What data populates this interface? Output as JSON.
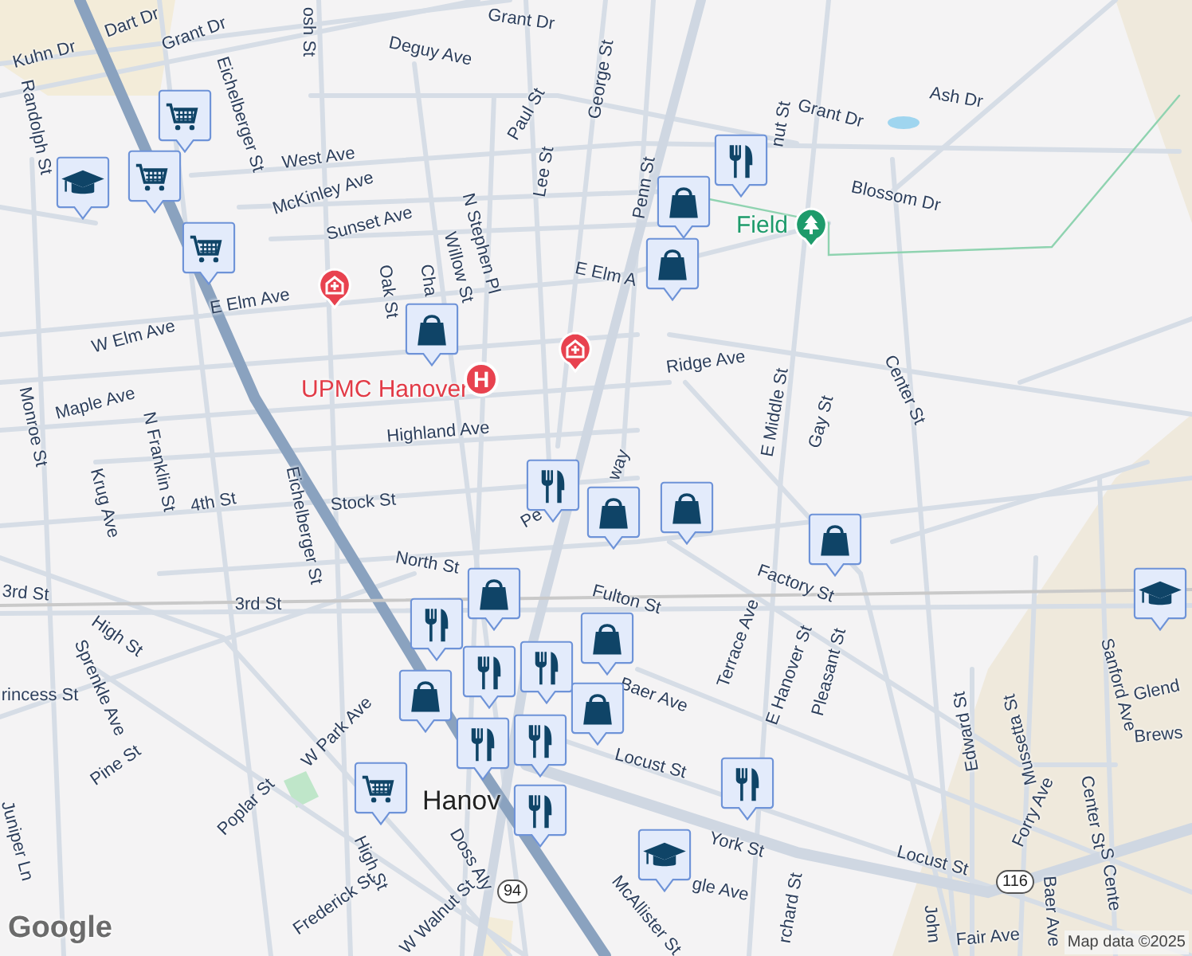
{
  "streets": [
    "Dart Dr",
    "Kuhn Dr",
    "Grant Dr",
    "Grant Dr",
    "Deguy Ave",
    "osh St",
    "Randolph St",
    "Eichelberger St",
    "Paul St",
    "West Ave",
    "McKinley Ave",
    "Sunset Ave",
    "Lee St",
    "N Stephen Pl",
    "Willow St",
    "E Elm Ave",
    "W Elm Ave",
    "Cha",
    "Oak St",
    "Maple Ave",
    "N Franklin St",
    "Monroe St",
    "Krug Ave",
    "Highland Ave",
    "Eichelberger St",
    "Stock St",
    "4th St",
    "George St",
    "Penn St",
    "Grant Dr",
    "Ash Dr",
    "Blossom Dr",
    "nut St",
    "E Elm A",
    "Ridge Ave",
    "E Middle St",
    "Gay St",
    "Center St",
    "way",
    "Pe",
    "North St",
    "3rd St",
    "3rd St",
    "High St",
    "Fulton St",
    "Factory St",
    "Terrace Ave",
    "E Hanover St",
    "Pleasant St",
    "Baer Ave",
    "rincess St",
    "Sprenkle Ave",
    "Pine St",
    "Juniper Ln",
    "W Park Ave",
    "Poplar St",
    "High St",
    "Locust St",
    "Locust St",
    "Doss Aly",
    "Frederick St",
    "W Walnut St",
    "York St",
    "McAllister St",
    "gle Ave",
    "rchard St",
    "John",
    "Fair Ave",
    "Baer Ave",
    "Center St",
    "S Cente",
    "Forry Ave",
    "Edward St",
    "Mussetta St",
    "Sanford Ave",
    "Glend",
    "Brews"
  ],
  "places": [
    {
      "kind": "hospital"
    },
    {
      "kind": "hospital"
    },
    {
      "kind": "hospital",
      "name": "UPMC Hanover",
      "symbol": "H"
    },
    {
      "kind": "park",
      "name": "Field"
    },
    {
      "kind": "city",
      "name": "Hanov"
    }
  ],
  "route_shields": [
    "94",
    "116"
  ],
  "markers": [
    {
      "kind": "grocery"
    },
    {
      "kind": "grocery"
    },
    {
      "kind": "school"
    },
    {
      "kind": "grocery"
    },
    {
      "kind": "shopping"
    },
    {
      "kind": "restaurant"
    },
    {
      "kind": "shopping"
    },
    {
      "kind": "shopping"
    },
    {
      "kind": "restaurant"
    },
    {
      "kind": "shopping"
    },
    {
      "kind": "shopping"
    },
    {
      "kind": "shopping"
    },
    {
      "kind": "school"
    },
    {
      "kind": "shopping"
    },
    {
      "kind": "shopping"
    },
    {
      "kind": "restaurant"
    },
    {
      "kind": "shopping"
    },
    {
      "kind": "restaurant"
    },
    {
      "kind": "restaurant"
    },
    {
      "kind": "restaurant"
    },
    {
      "kind": "restaurant"
    },
    {
      "kind": "shopping"
    },
    {
      "kind": "grocery"
    },
    {
      "kind": "restaurant"
    },
    {
      "kind": "restaurant"
    },
    {
      "kind": "school"
    }
  ],
  "attribution": {
    "logo": "Google",
    "text": "Map data ©2025"
  }
}
